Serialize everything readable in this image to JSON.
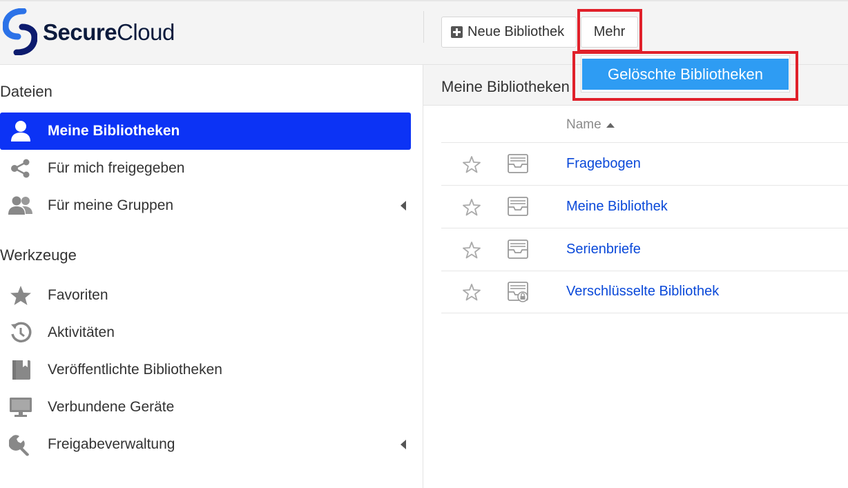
{
  "brand": {
    "name_bold": "Secure",
    "name_regular": "Cloud"
  },
  "toolbar": {
    "new_library_label": "Neue Bibliothek",
    "more_label": "Mehr"
  },
  "more_menu": {
    "items": [
      {
        "label": "Gelöschte Bibliotheken"
      }
    ]
  },
  "sidebar": {
    "files_title": "Dateien",
    "files_items": [
      {
        "label": "Meine Bibliotheken",
        "icon": "user-icon",
        "active": true
      },
      {
        "label": "Für mich freigegeben",
        "icon": "share-icon"
      },
      {
        "label": "Für meine Gruppen",
        "icon": "group-icon",
        "has_caret": true
      }
    ],
    "tools_title": "Werkzeuge",
    "tools_items": [
      {
        "label": "Favoriten",
        "icon": "star-icon"
      },
      {
        "label": "Aktivitäten",
        "icon": "history-icon"
      },
      {
        "label": "Veröffentlichte Bibliotheken",
        "icon": "book-icon"
      },
      {
        "label": "Verbundene Geräte",
        "icon": "monitor-icon"
      },
      {
        "label": "Freigabeverwaltung",
        "icon": "wrench-icon",
        "has_caret": true
      }
    ]
  },
  "main": {
    "title": "Meine Bibliotheken",
    "column_name": "Name",
    "libraries": [
      {
        "name": "Fragebogen",
        "icon": "library-icon"
      },
      {
        "name": "Meine Bibliothek",
        "icon": "library-icon"
      },
      {
        "name": "Serienbriefe",
        "icon": "library-icon"
      },
      {
        "name": "Verschlüsselte Bibliothek",
        "icon": "encrypted-library-icon"
      }
    ]
  },
  "colors": {
    "accent": "#0c33f5",
    "link": "#0a49d9",
    "menu_highlight": "#2e9cf3",
    "annotation": "#e0202a"
  }
}
